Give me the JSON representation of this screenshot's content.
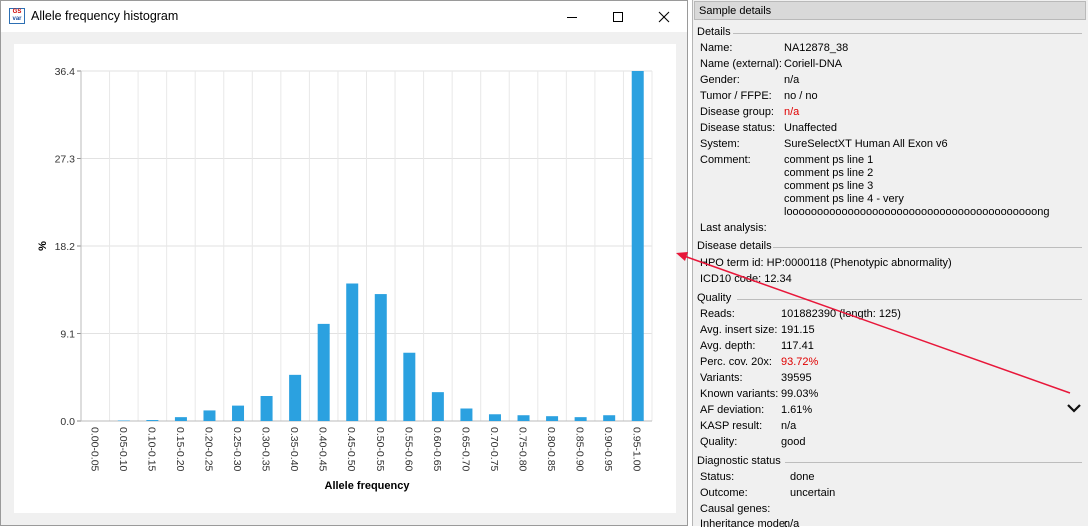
{
  "window": {
    "title": "Allele frequency histogram",
    "icon_text_top": "GS",
    "icon_text_bottom": "var"
  },
  "chart_data": {
    "type": "bar",
    "title": "",
    "xlabel": "Allele frequency",
    "ylabel": "%",
    "ylim": [
      0,
      36.4
    ],
    "yticks": [
      "0.0",
      "9.1",
      "18.2",
      "27.3",
      "36.4"
    ],
    "categories": [
      "0.00-0.05",
      "0.05-0.10",
      "0.10-0.15",
      "0.15-0.20",
      "0.20-0.25",
      "0.25-0.30",
      "0.30-0.35",
      "0.35-0.40",
      "0.40-0.45",
      "0.45-0.50",
      "0.50-0.55",
      "0.55-0.60",
      "0.60-0.65",
      "0.65-0.70",
      "0.70-0.75",
      "0.75-0.80",
      "0.80-0.85",
      "0.85-0.90",
      "0.90-0.95",
      "0.95-1.00"
    ],
    "values": [
      0.0,
      0.05,
      0.1,
      0.4,
      1.1,
      1.6,
      2.6,
      4.8,
      10.1,
      14.3,
      13.2,
      7.1,
      3.0,
      1.3,
      0.7,
      0.6,
      0.5,
      0.4,
      0.6,
      36.4
    ],
    "bar_color": "#2ba1e0",
    "grid": true
  },
  "details": {
    "header": "Sample details",
    "sections": {
      "details": "Details",
      "disease": "Disease details",
      "quality": "Quality",
      "diagnostic": "Diagnostic status"
    },
    "fields": {
      "name_label": "Name:",
      "name_value": "NA12878_38",
      "name_ext_label": "Name (external):",
      "name_ext_value": "Coriell-DNA",
      "gender_label": "Gender:",
      "gender_value": "n/a",
      "tumor_label": "Tumor / FFPE:",
      "tumor_value": "no / no",
      "disease_group_label": "Disease group:",
      "disease_group_value": "n/a",
      "disease_status_label": "Disease status:",
      "disease_status_value": "Unaffected",
      "system_label": "System:",
      "system_value": "SureSelectXT Human All Exon v6",
      "comment_label": "Comment:",
      "comment_lines": [
        "comment ps line 1",
        "comment ps line 2",
        "comment ps line 3",
        "comment ps line 4 - very",
        "looooooooooooooooooooooooooooooooooooooooong"
      ],
      "last_analysis_label": "Last analysis:",
      "hpo": "HPO term id: HP:0000118 (Phenotypic abnormality)",
      "icd10": "ICD10 code: 12.34",
      "reads_label": "Reads:",
      "reads_value": "101882390 (length: 125)",
      "insert_label": "Avg. insert size:",
      "insert_value": "191.15",
      "depth_label": "Avg. depth:",
      "depth_value": "117.41",
      "cov_label": "Perc. cov. 20x:",
      "cov_value": "93.72%",
      "variants_label": "Variants:",
      "variants_value": "39595",
      "known_label": "Known variants:",
      "known_value": "99.03%",
      "af_label": "AF deviation:",
      "af_value": "1.61%",
      "kasp_label": "KASP result:",
      "kasp_value": "n/a",
      "quality_label": "Quality:",
      "quality_value": "good",
      "status_label": "Status:",
      "status_value": "done",
      "outcome_label": "Outcome:",
      "outcome_value": "uncertain",
      "causal_label": "Causal genes:",
      "inheritance_label": "Inheritance mode:",
      "inheritance_value": "n/a"
    }
  },
  "colors": {
    "bar": "#2ba1e0",
    "annotation_arrow": "#e8173a",
    "warning_text": "#e00000"
  },
  "icons": [
    "minimize-icon",
    "maximize-icon",
    "close-icon",
    "chevron-down-icon"
  ]
}
